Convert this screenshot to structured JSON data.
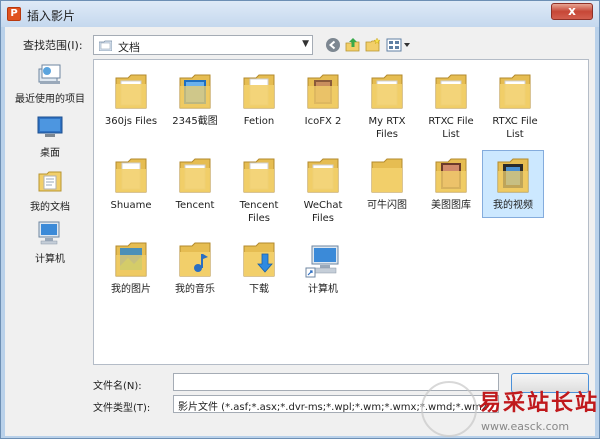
{
  "window": {
    "title": "插入影片",
    "close_glyph": "x"
  },
  "toolbar": {
    "lookin_label": "查找范围(I):",
    "lookin_value": "文档"
  },
  "places": [
    {
      "label": "最近使用的项目",
      "icon": "recent-items-icon"
    },
    {
      "label": "桌面",
      "icon": "desktop-icon"
    },
    {
      "label": "我的文档",
      "icon": "documents-icon"
    },
    {
      "label": "计算机",
      "icon": "computer-icon"
    }
  ],
  "items": [
    {
      "label": "360js Files",
      "icon": "folder-icon"
    },
    {
      "label": "2345截图",
      "icon": "folder-icon"
    },
    {
      "label": "Fetion",
      "icon": "folder-icon"
    },
    {
      "label": "IcoFX 2",
      "icon": "folder-icon"
    },
    {
      "label": "My RTX Files",
      "icon": "folder-icon"
    },
    {
      "label": "RTXC File List",
      "icon": "folder-icon"
    },
    {
      "label": "RTXC File List",
      "icon": "folder-icon"
    },
    {
      "label": "Shuame",
      "icon": "folder-icon"
    },
    {
      "label": "Tencent",
      "icon": "folder-icon"
    },
    {
      "label": "Tencent Files",
      "icon": "folder-icon"
    },
    {
      "label": "WeChat Files",
      "icon": "folder-icon"
    },
    {
      "label": "可牛闪图",
      "icon": "folder-icon"
    },
    {
      "label": "美图图库",
      "icon": "folder-icon"
    },
    {
      "label": "我的视频",
      "icon": "videos-folder-icon",
      "selected": true
    },
    {
      "label": "我的图片",
      "icon": "pictures-folder-icon"
    },
    {
      "label": "我的音乐",
      "icon": "music-folder-icon"
    },
    {
      "label": "下载",
      "icon": "downloads-folder-icon"
    },
    {
      "label": "计算机",
      "icon": "computer-shortcut-icon"
    }
  ],
  "footer": {
    "filename_label": "文件名(N):",
    "filename_value": "",
    "filetype_label": "文件类型(T):",
    "filetype_value": "影片文件 (*.asf;*.asx;*.dvr-ms;*.wpl;*.wm;*.wmx;*.wmd;*.wmz"
  },
  "watermark": {
    "text": "易采站长站",
    "url": "www.easck.com"
  },
  "colors": {
    "folder": "#f2cf6a",
    "selection": "#cce8ff",
    "accent": "#4a90d9",
    "watermark": "#c0191c"
  }
}
